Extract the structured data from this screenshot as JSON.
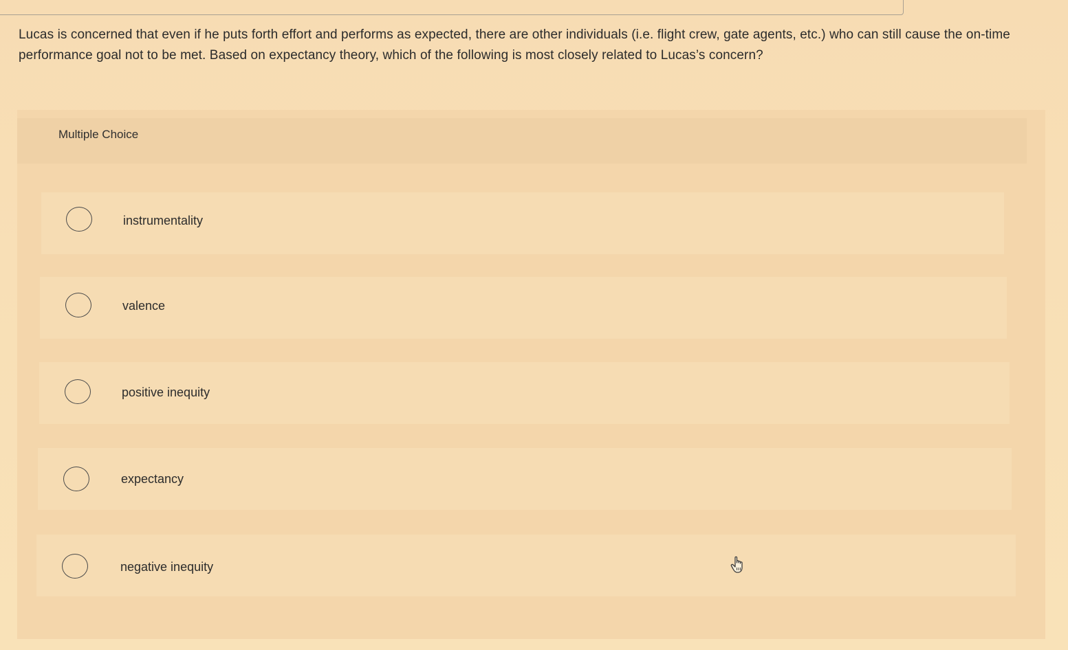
{
  "question": {
    "text": "Lucas is concerned that even if he puts forth effort and performs as expected, there are other individuals (i.e. flight crew, gate agents, etc.) who can still cause the on-time performance goal not to be met. Based on expectancy theory, which of the following is most closely related to Lucas’s concern?"
  },
  "multiple_choice": {
    "label": "Multiple Choice",
    "options": [
      {
        "label": "instrumentality",
        "selected": false
      },
      {
        "label": "valence",
        "selected": false
      },
      {
        "label": "positive inequity",
        "selected": false
      },
      {
        "label": "expectancy",
        "selected": false
      },
      {
        "label": "negative inequity",
        "selected": false
      }
    ]
  },
  "icons": {
    "cursor": "hand-pointer-icon"
  }
}
